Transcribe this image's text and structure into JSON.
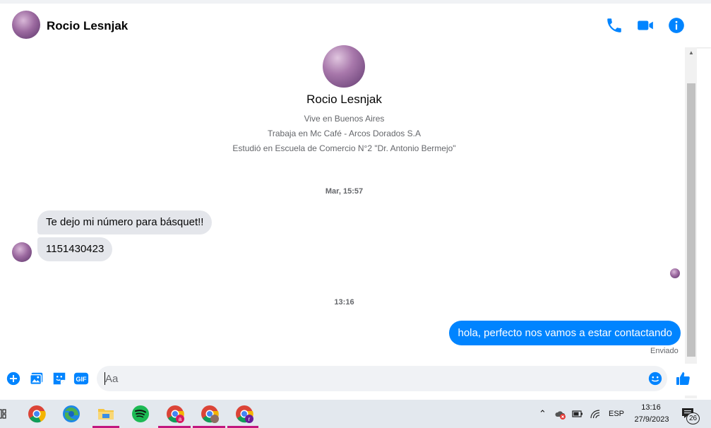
{
  "header": {
    "contact_name": "Rocio Lesnjak"
  },
  "profile": {
    "name": "Rocio Lesnjak",
    "lives": "Vive en Buenos Aires",
    "works": "Trabaja en Mc Café - Arcos Dorados S.A",
    "studied": "Estudió en Escuela de Comercio N°2 \"Dr. Antonio Bermejo\""
  },
  "messages": {
    "timestamp_1": "Mar, 15:57",
    "incoming_1": "Te dejo mi número para básquet!!",
    "incoming_2": "1151430423",
    "timestamp_2": "13:16",
    "outgoing_1": "hola, perfecto nos vamos a estar contactando",
    "sent_status": "Enviado"
  },
  "composer": {
    "placeholder": "Aa"
  },
  "taskbar": {
    "language": "ESP",
    "time": "13:16",
    "date": "27/9/2023",
    "notification_count": "26"
  },
  "colors": {
    "accent": "#0084ff",
    "incoming_bubble": "#e4e6eb"
  }
}
